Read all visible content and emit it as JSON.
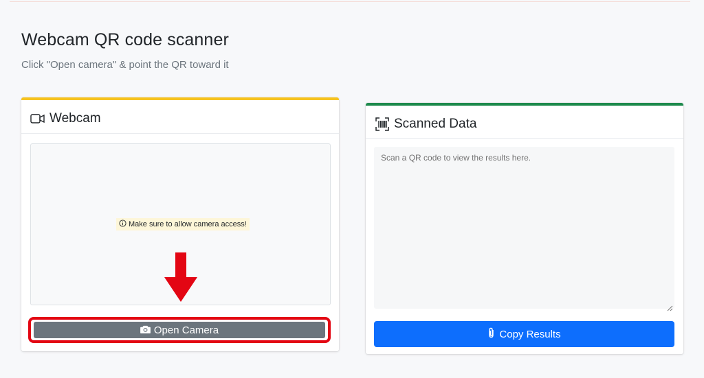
{
  "page": {
    "title": "Webcam QR code scanner",
    "subtitle": "Click \"Open camera\" & point the QR toward it"
  },
  "webcam_card": {
    "title": "Webcam",
    "notice": "Make sure to allow camera access!",
    "open_camera_label": "Open Camera",
    "accent_color": "#f7c31d"
  },
  "scanned_card": {
    "title": "Scanned Data",
    "results_placeholder": "Scan a QR code to view the results here.",
    "copy_results_label": "Copy Results",
    "accent_color": "#1e8a4c"
  },
  "icons": {
    "webcam": "video-camera-icon",
    "scanned": "barcode-scan-icon",
    "notice": "info-circle-icon",
    "open_camera": "camera-icon",
    "copy": "paperclip-icon",
    "arrow": "red-down-arrow-icon"
  },
  "colors": {
    "highlight": "#e30613",
    "secondary_button": "#6c757d",
    "primary_button": "#0d6efd"
  }
}
